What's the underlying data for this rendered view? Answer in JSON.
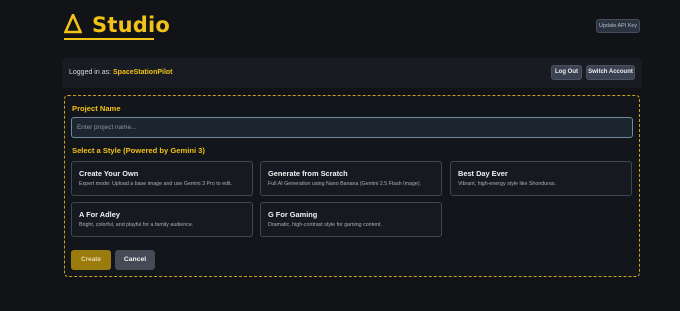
{
  "header": {
    "logo_text": "Studio",
    "logo_icon": "delta-icon",
    "api_key_button": "Update API Key"
  },
  "account": {
    "logged_in_label": "Logged in as:",
    "username": "SpaceStationPilot",
    "logout_button": "Log Out",
    "switch_button": "Switch Account"
  },
  "form": {
    "project_name_label": "Project Name",
    "project_name_placeholder": "Enter project name...",
    "style_label": "Select a Style (Powered by Gemini 3)",
    "styles": [
      {
        "title": "Create Your Own",
        "description": "Expert mode: Upload a base image and use Gemini 3 Pro to edit."
      },
      {
        "title": "Generate from Scratch",
        "description": "Full AI Generation using Nano Banana (Gemini 2.5 Flash Image)."
      },
      {
        "title": "Best Day Ever",
        "description": "Vibrant, high-energy style like Shonduras."
      },
      {
        "title": "A For Adley",
        "description": "Bright, colorful, and playful for a family audience."
      },
      {
        "title": "G For Gaming",
        "description": "Dramatic, high-contrast style for gaming content."
      }
    ],
    "create_button": "Create",
    "cancel_button": "Cancel"
  },
  "colors": {
    "accent": "#f2c218",
    "background": "#111317",
    "create_button": "#9a7b0c",
    "cancel_button": "#444b57"
  }
}
